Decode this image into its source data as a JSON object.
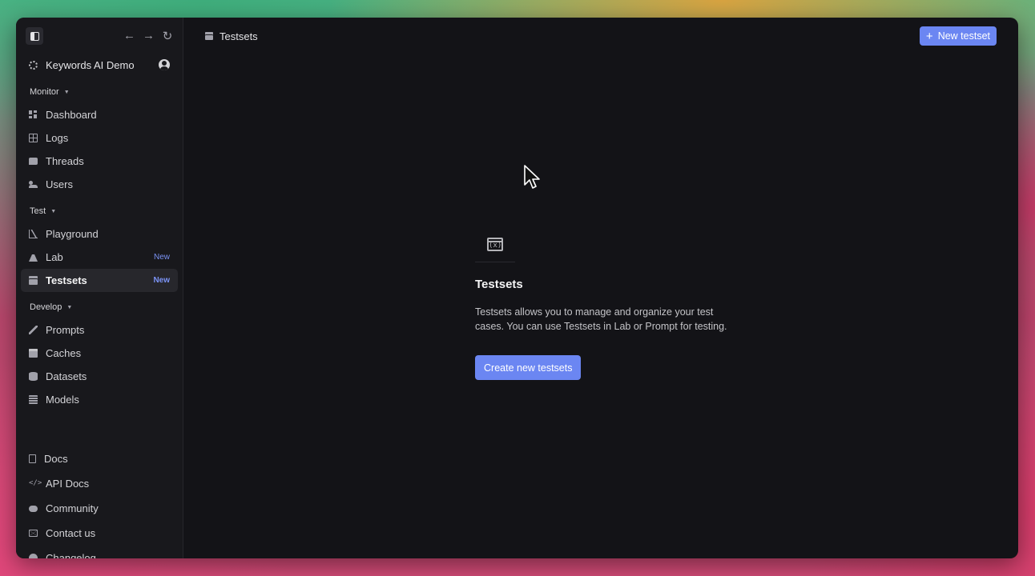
{
  "sidebar": {
    "org_name": "Keywords AI Demo",
    "sections": {
      "monitor": "Monitor",
      "test": "Test",
      "develop": "Develop"
    },
    "monitor_items": [
      "Dashboard",
      "Logs",
      "Threads",
      "Users"
    ],
    "test_items": [
      {
        "label": "Playground",
        "badge": ""
      },
      {
        "label": "Lab",
        "badge": "New"
      },
      {
        "label": "Testsets",
        "badge": "New",
        "active": true
      }
    ],
    "develop_items": [
      "Prompts",
      "Caches",
      "Datasets",
      "Models"
    ],
    "bottom_items": [
      "Docs",
      "API Docs",
      "Community",
      "Contact us",
      "Changelog"
    ],
    "nav_glyphs": {
      "back": "←",
      "forward": "→",
      "reload": "↻"
    }
  },
  "header": {
    "breadcrumb": "Testsets",
    "new_button": "New testset",
    "new_button_glyph": "+"
  },
  "empty_state": {
    "icon_glyph": "(x)",
    "title": "Testsets",
    "description": "Testsets allows you to manage and organize your test cases. You can use Testsets in Lab or Prompt for testing.",
    "cta": "Create new testsets"
  },
  "colors": {
    "accent": "#6b86f2",
    "badge": "#7b93f5",
    "window_bg": "#131317",
    "sidebar_bg": "#18181c"
  }
}
